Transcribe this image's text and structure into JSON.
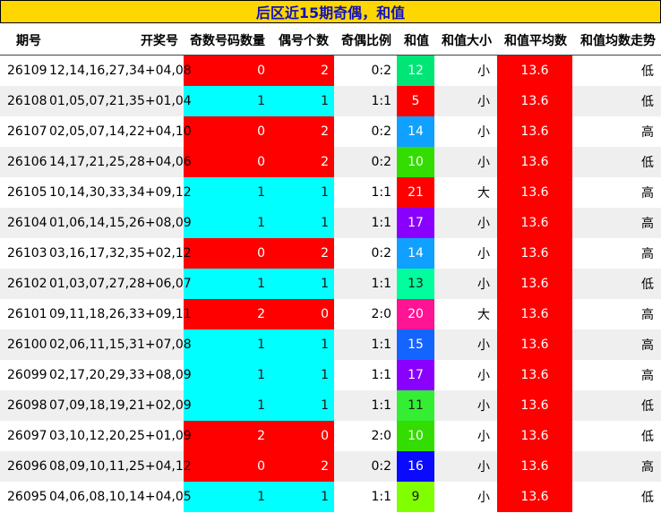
{
  "title": "后区近15期奇偶，和值",
  "headers": [
    "期号",
    "开奖号",
    "奇数号码数量",
    "偶号个数",
    "奇偶比例",
    "和值",
    "和值大小",
    "和值平均数",
    "和值均数走势"
  ],
  "colors": {
    "title_bg": "#ffd700",
    "title_text": "#1010c0",
    "count_red": "#ff0000",
    "count_cyan": "#00ffff",
    "average_bg": "#ff0000"
  },
  "rows": [
    {
      "issue": "26109",
      "numbers": "12,14,16,27,34+04,08",
      "odd": "0",
      "even": "2",
      "ratio": "0:2",
      "sum": "12",
      "sum_color": "#00e676",
      "size": "小",
      "avg": "13.6",
      "trend": "低"
    },
    {
      "issue": "26108",
      "numbers": "01,05,07,21,35+01,04",
      "odd": "1",
      "even": "1",
      "ratio": "1:1",
      "sum": "5",
      "sum_color": "#ff0000",
      "size": "小",
      "avg": "13.6",
      "trend": "低"
    },
    {
      "issue": "26107",
      "numbers": "02,05,07,14,22+04,10",
      "odd": "0",
      "even": "2",
      "ratio": "0:2",
      "sum": "14",
      "sum_color": "#10a0ff",
      "size": "小",
      "avg": "13.6",
      "trend": "高"
    },
    {
      "issue": "26106",
      "numbers": "14,17,21,25,28+04,06",
      "odd": "0",
      "even": "2",
      "ratio": "0:2",
      "sum": "10",
      "sum_color": "#33dd00",
      "size": "小",
      "avg": "13.6",
      "trend": "低"
    },
    {
      "issue": "26105",
      "numbers": "10,14,30,33,34+09,12",
      "odd": "1",
      "even": "1",
      "ratio": "1:1",
      "sum": "21",
      "sum_color": "#ff0000",
      "size": "大",
      "avg": "13.6",
      "trend": "高"
    },
    {
      "issue": "26104",
      "numbers": "01,06,14,15,26+08,09",
      "odd": "1",
      "even": "1",
      "ratio": "1:1",
      "sum": "17",
      "sum_color": "#8a00ff",
      "size": "小",
      "avg": "13.6",
      "trend": "高"
    },
    {
      "issue": "26103",
      "numbers": "03,16,17,32,35+02,12",
      "odd": "0",
      "even": "2",
      "ratio": "0:2",
      "sum": "14",
      "sum_color": "#10a0ff",
      "size": "小",
      "avg": "13.6",
      "trend": "高"
    },
    {
      "issue": "26102",
      "numbers": "01,03,07,27,28+06,07",
      "odd": "1",
      "even": "1",
      "ratio": "1:1",
      "sum": "13",
      "sum_color": "#00ff9c",
      "size": "小",
      "avg": "13.6",
      "trend": "低"
    },
    {
      "issue": "26101",
      "numbers": "09,11,18,26,33+09,11",
      "odd": "2",
      "even": "0",
      "ratio": "2:0",
      "sum": "20",
      "sum_color": "#ff1493",
      "size": "大",
      "avg": "13.6",
      "trend": "高"
    },
    {
      "issue": "26100",
      "numbers": "02,06,11,15,31+07,08",
      "odd": "1",
      "even": "1",
      "ratio": "1:1",
      "sum": "15",
      "sum_color": "#1464ff",
      "size": "小",
      "avg": "13.6",
      "trend": "高"
    },
    {
      "issue": "26099",
      "numbers": "02,17,20,29,33+08,09",
      "odd": "1",
      "even": "1",
      "ratio": "1:1",
      "sum": "17",
      "sum_color": "#8a00ff",
      "size": "小",
      "avg": "13.6",
      "trend": "高"
    },
    {
      "issue": "26098",
      "numbers": "07,09,18,19,21+02,09",
      "odd": "1",
      "even": "1",
      "ratio": "1:1",
      "sum": "11",
      "sum_color": "#33ee33",
      "size": "小",
      "avg": "13.6",
      "trend": "低"
    },
    {
      "issue": "26097",
      "numbers": "03,10,12,20,25+01,09",
      "odd": "2",
      "even": "0",
      "ratio": "2:0",
      "sum": "10",
      "sum_color": "#33dd00",
      "size": "小",
      "avg": "13.6",
      "trend": "低"
    },
    {
      "issue": "26096",
      "numbers": "08,09,10,11,25+04,12",
      "odd": "0",
      "even": "2",
      "ratio": "0:2",
      "sum": "16",
      "sum_color": "#0a0aff",
      "size": "小",
      "avg": "13.6",
      "trend": "高"
    },
    {
      "issue": "26095",
      "numbers": "04,06,08,10,14+04,05",
      "odd": "1",
      "even": "1",
      "ratio": "1:1",
      "sum": "9",
      "sum_color": "#80ff00",
      "size": "小",
      "avg": "13.6",
      "trend": "低"
    }
  ]
}
